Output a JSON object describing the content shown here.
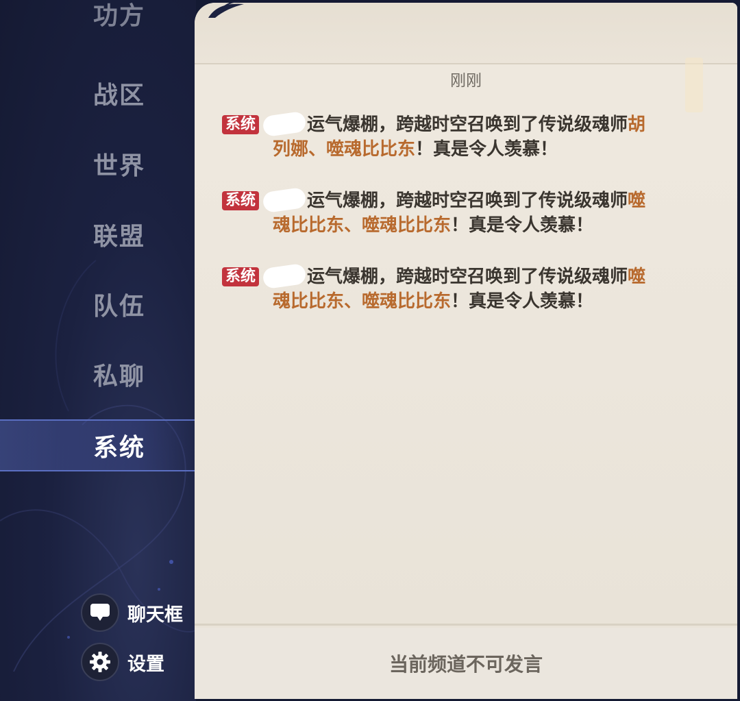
{
  "sidebar": {
    "tabs": [
      {
        "label": "功方",
        "state": "cut"
      },
      {
        "label": "战区"
      },
      {
        "label": "世界"
      },
      {
        "label": "联盟"
      },
      {
        "label": "队伍"
      },
      {
        "label": "私聊"
      },
      {
        "label": "系统",
        "state": "active"
      }
    ],
    "tools": [
      {
        "label": "聊天框",
        "icon": "chat-bubble-icon"
      },
      {
        "label": "设置",
        "icon": "gear-icon"
      }
    ]
  },
  "panel": {
    "timestamp": "刚刚",
    "messages": [
      {
        "tag": "系统",
        "text1": "运气爆棚，跨越时空召唤到了传说级魂师",
        "highlight1": "胡",
        "highlight2": "列娜、噬魂比比东",
        "text2": "！真是令人羡慕！"
      },
      {
        "tag": "系统",
        "text1": "运气爆棚，跨越时空召唤到了传说级魂师",
        "highlight1": "噬",
        "highlight2": "魂比比东、噬魂比比东",
        "text2": "！真是令人羡慕！"
      },
      {
        "tag": "系统",
        "text1": "运气爆棚，跨越时空召唤到了传说级魂师",
        "highlight1": "噬",
        "highlight2": "魂比比东、噬魂比比东",
        "text2": "！真是令人羡慕！"
      }
    ],
    "footer": "当前频道不可发言"
  },
  "colors": {
    "sidebar_bg": "#1b2140",
    "panel_bg": "#ece6dc",
    "tag_red": "#c2333d",
    "highlight_orange": "#b86a2e",
    "active_border": "#5b6fc2"
  }
}
